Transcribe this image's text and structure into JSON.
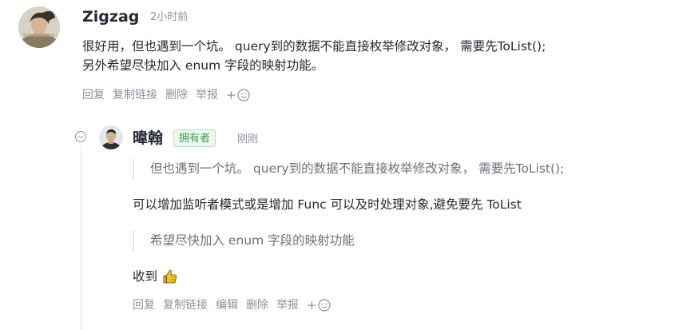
{
  "comment": {
    "username": "Zigzag",
    "time": "2小时前",
    "content_lines": [
      "很好用，但也遇到一个坑。 query到的数据不能直接枚举修改对象， 需要先ToList();",
      "另外希望尽快加入 enum 字段的映射功能。"
    ],
    "actions": {
      "reply": "回复",
      "copy_link": "复制链接",
      "delete": "删除",
      "report": "举报",
      "emoji_plus": "+"
    },
    "avatar_icon": "user-avatar-photo"
  },
  "reply": {
    "username": "暐翰",
    "badge": "拥有者",
    "time": "刚刚",
    "quote1": "但也遇到一个坑。 query到的数据不能直接枚举修改对象， 需要先ToList();",
    "text1": "可以增加监听者模式或是增加 Func 可以及时处理对象,避免要先 ToList",
    "quote2": "希望尽快加入 enum 字段的映射功能",
    "text2": "收到",
    "text2_emoji": "thumbs-up-icon",
    "actions": {
      "reply": "回复",
      "copy_link": "复制链接",
      "edit": "编辑",
      "delete": "删除",
      "report": "举报",
      "emoji_plus": "+"
    },
    "collapse_icon": "collapse-minus-icon"
  },
  "colors": {
    "text": "#252933",
    "muted": "#8a919f",
    "badge_green": "#3b9e52",
    "badge_bg": "#eef8f0",
    "quote_border": "#e4e6eb"
  }
}
